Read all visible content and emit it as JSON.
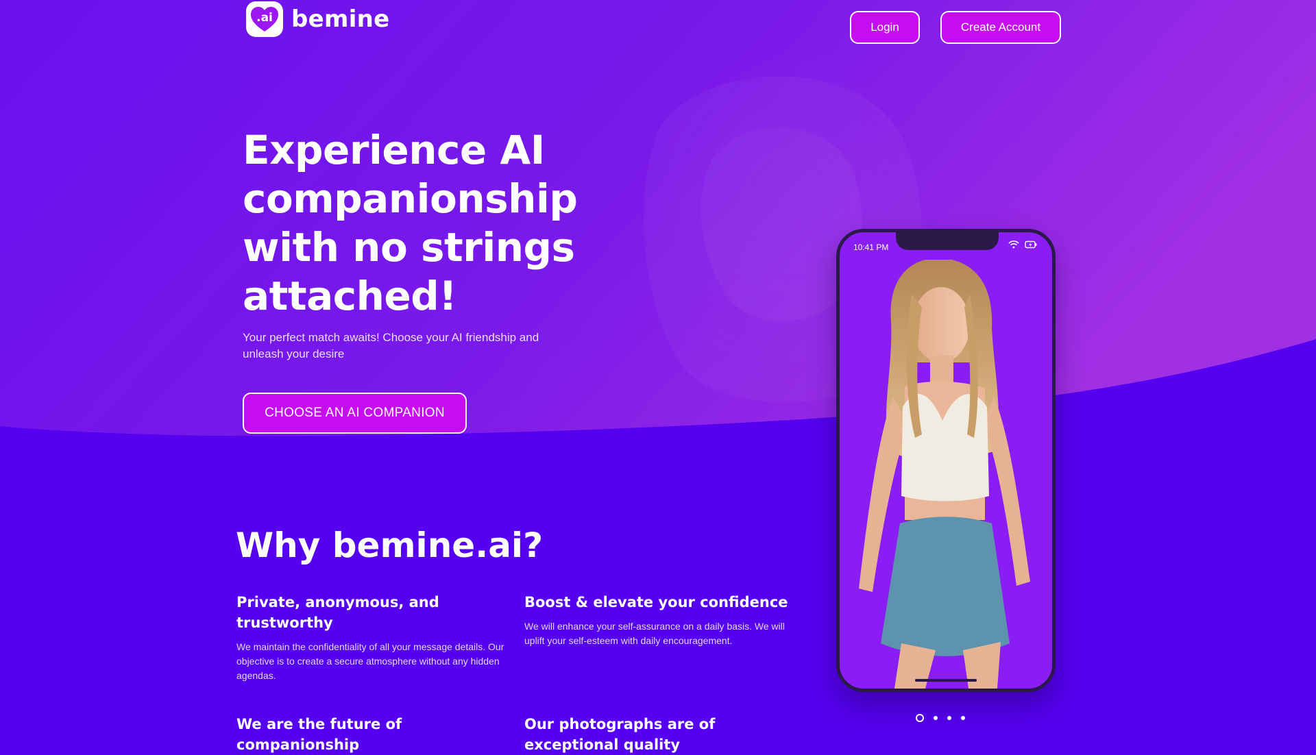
{
  "brand": {
    "name": "bemine",
    "badge": ".ai"
  },
  "nav": {
    "login_label": "Login",
    "create_account_label": "Create Account"
  },
  "hero": {
    "title": "Experience AI companionship with no strings attached!",
    "subtitle": "Your perfect match awaits! Choose your AI friendship and unleash your desire",
    "cta_label": "CHOOSE AN AI COMPANION"
  },
  "why": {
    "title": "Why bemine.ai?",
    "features": [
      {
        "title": "Private, anonymous, and trustworthy",
        "text": "We maintain the confidentiality of all your message details. Our objective is to create a secure atmosphere without any hidden agendas."
      },
      {
        "title": "Boost & elevate your confidence",
        "text": "We will enhance your self-assurance on a daily basis. We will uplift your self-esteem with daily encouragement."
      },
      {
        "title": "We are the future of companionship",
        "text": ""
      },
      {
        "title": "Our photographs are of exceptional quality",
        "text": ""
      }
    ]
  },
  "phone": {
    "time": "10:41 PM",
    "status_icons": [
      "wifi-icon",
      "battery-charging-icon"
    ]
  },
  "carousel": {
    "slide_count": 4,
    "active_index": 0
  },
  "colors": {
    "background": "#5500ee",
    "hero_gradient_start": "#6c12ee",
    "hero_gradient_end": "#a52ee6",
    "button_fill": "#c60df2",
    "phone_frame": "#2a1a4a"
  }
}
